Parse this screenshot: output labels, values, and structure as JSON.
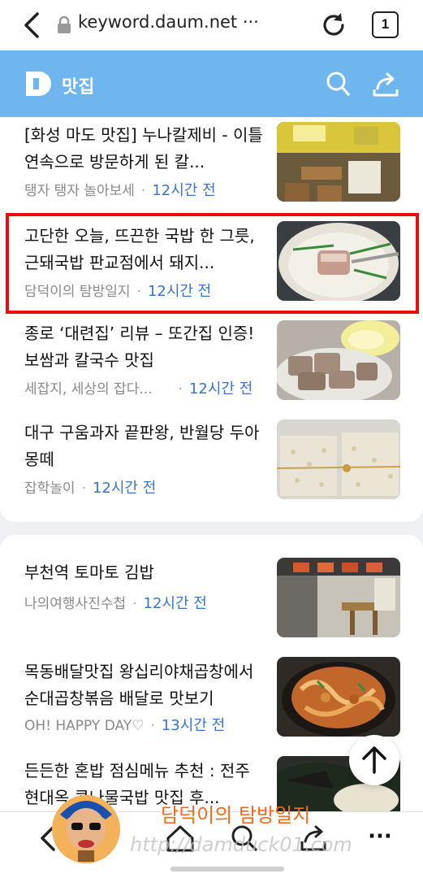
{
  "browser": {
    "url": "keyword.daum.net ···",
    "tab_count": "1",
    "icons": [
      "back-arrow-icon",
      "lock-icon",
      "reload-icon",
      "tab-count-icon"
    ]
  },
  "header": {
    "logo_letter": "D",
    "title": "맛집",
    "icons": [
      "search-icon",
      "share-icon"
    ],
    "bg_color": "#6fb6ee"
  },
  "section1": {
    "items": [
      {
        "title": "[화성 마도 맛집] 누나칼제비 - 이틀 연속으로 방문하게 된 칼...",
        "source": "탱자 탱자 놀아보세",
        "time": "12시간 전"
      },
      {
        "title": "고단한 오늘, 뜨끈한 국밥 한 그릇, 근돼국밥 판교점에서 돼지...",
        "source": "담덕이의 탐방일지",
        "time": "12시간 전"
      },
      {
        "title": "종로 ‘대련집’ 리뷰 – 또간집 인증! 보쌈과 칼국수 맛집",
        "source": "세잡지, 세상의 잡다...",
        "time": "12시간 전"
      },
      {
        "title": "대구 구움과자 끝판왕, 반월당 두아몽떼",
        "source": "잡학놀이",
        "time": "12시간 전"
      }
    ]
  },
  "section2": {
    "items": [
      {
        "title": "부천역 토마토 김밥",
        "source": "나의여행사진수첩",
        "time": "12시간 전"
      },
      {
        "title": "목동배달맛집 왕십리야채곱창에서 순대곱창볶음 배달로 맛보기",
        "source": "OH! HAPPY DAY♡",
        "time": "13시간 전"
      },
      {
        "title": "든든한 혼밥 점심메뉴 추천 : 전주현대옥 콩나물국밥 맛집 후...",
        "source": "",
        "time": ""
      }
    ]
  },
  "bottom_nav": {
    "icons": [
      "back-icon",
      "home-icon",
      "search-icon",
      "share-icon",
      "more-icon"
    ],
    "more_label": "···"
  },
  "watermark": {
    "title": "담덕이의 탐방일지",
    "url": "http://damduck01.com"
  },
  "colors": {
    "highlight_border": "#ee0b0b",
    "time_text": "#3b74c9",
    "watermark_title": "#f26a1b"
  }
}
